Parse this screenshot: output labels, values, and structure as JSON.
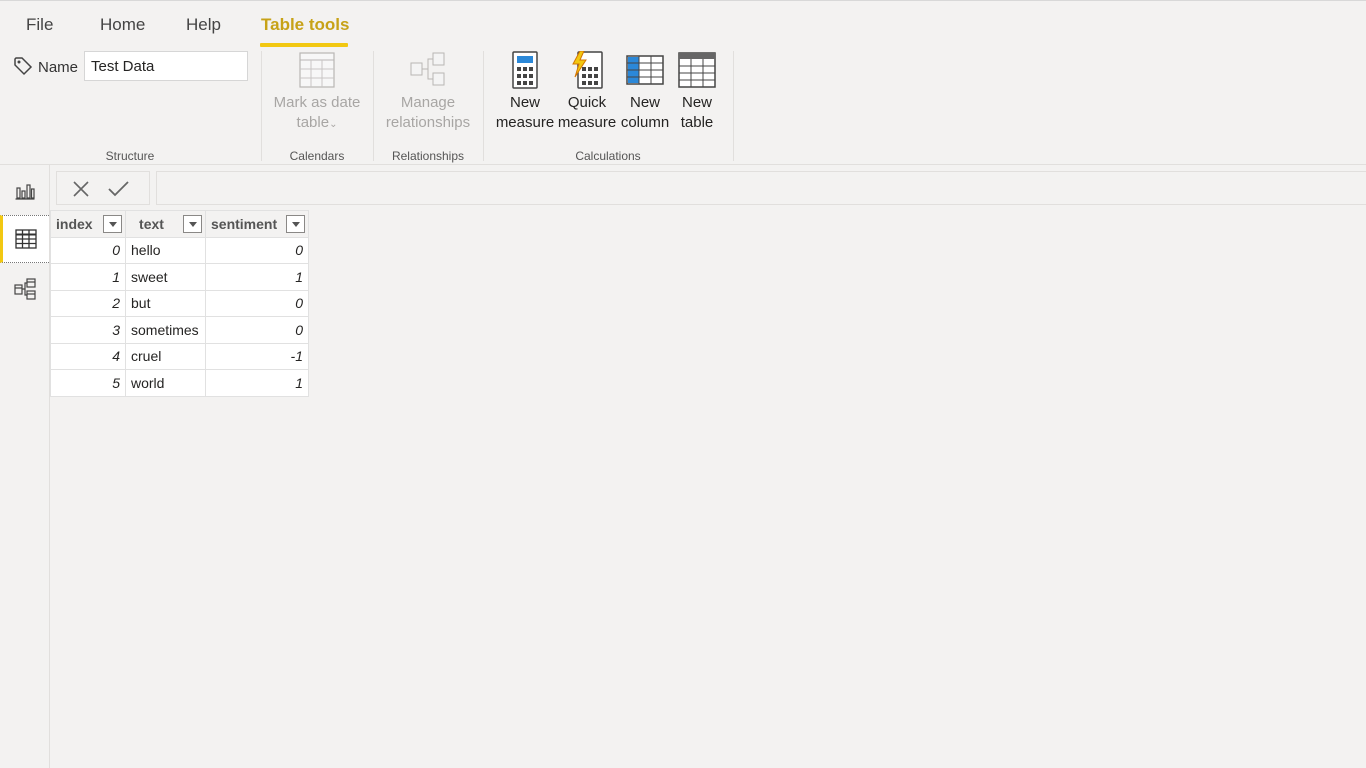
{
  "menu": {
    "tabs": [
      {
        "label": "File"
      },
      {
        "label": "Home"
      },
      {
        "label": "Help"
      },
      {
        "label": "Table tools",
        "active": true
      }
    ]
  },
  "ribbon": {
    "structure": {
      "name_label": "Name",
      "name_value": "Test Data",
      "group_label": "Structure"
    },
    "calendars": {
      "mark_date_table_line1": "Mark as date",
      "mark_date_table_line2": "table",
      "group_label": "Calendars"
    },
    "relationships": {
      "manage_line1": "Manage",
      "manage_line2": "relationships",
      "group_label": "Relationships"
    },
    "calculations": {
      "new_measure_line1": "New",
      "new_measure_line2": "measure",
      "quick_measure_line1": "Quick",
      "quick_measure_line2": "measure",
      "new_column_line1": "New",
      "new_column_line2": "column",
      "new_table_line1": "New",
      "new_table_line2": "table",
      "group_label": "Calculations"
    }
  },
  "colors": {
    "accent": "#f2c811",
    "active_tab_text": "#c7a217",
    "background": "#f3f2f1"
  },
  "leftnav": {
    "items": [
      {
        "icon": "report-view-icon"
      },
      {
        "icon": "data-view-icon",
        "active": true
      },
      {
        "icon": "model-view-icon"
      }
    ]
  },
  "table": {
    "columns": [
      "index",
      "text",
      "sentiment"
    ],
    "rows": [
      {
        "index": "0",
        "text": "hello",
        "sentiment": "0"
      },
      {
        "index": "1",
        "text": "sweet",
        "sentiment": "1"
      },
      {
        "index": "2",
        "text": "but",
        "sentiment": "0"
      },
      {
        "index": "3",
        "text": "sometimes",
        "sentiment": "0"
      },
      {
        "index": "4",
        "text": "cruel",
        "sentiment": "-1"
      },
      {
        "index": "5",
        "text": "world",
        "sentiment": "1"
      }
    ]
  }
}
